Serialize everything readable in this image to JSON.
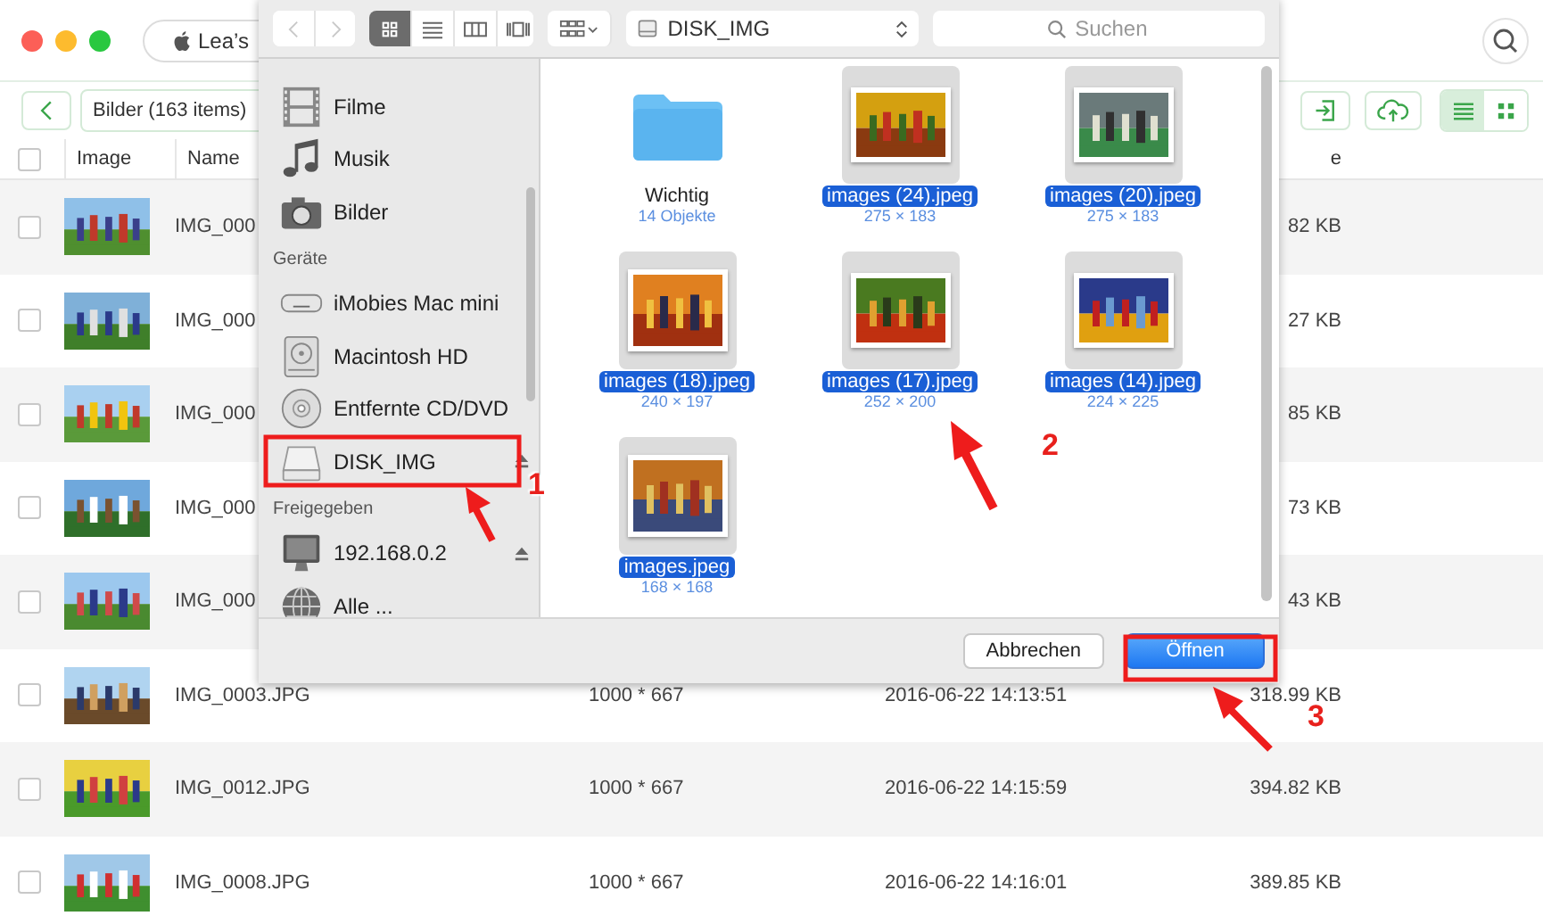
{
  "app": {
    "device_pill": "Lea’s",
    "breadcrumb": "Bilder (163 items)",
    "view_toggle": [
      {
        "kind": "list",
        "selected": true
      },
      {
        "kind": "grid",
        "selected": false
      }
    ],
    "table": {
      "select_all_checked": false,
      "columns": [
        "Image",
        "Name",
        "e"
      ],
      "rows": [
        {
          "checked": false,
          "name": "IMG_000",
          "size": "82 KB"
        },
        {
          "checked": false,
          "name": "IMG_000",
          "size": "27 KB"
        },
        {
          "checked": false,
          "name": "IMG_000",
          "size": "85 KB"
        },
        {
          "checked": false,
          "name": "IMG_000",
          "size": "73 KB"
        },
        {
          "checked": false,
          "name": "IMG_000",
          "size": "43 KB"
        },
        {
          "checked": false,
          "name": "IMG_0003.JPG",
          "dimensions": "1000 * 667",
          "date": "2016-06-22 14:13:51",
          "size": "318.99 KB"
        },
        {
          "checked": false,
          "name": "IMG_0012.JPG",
          "dimensions": "1000 * 667",
          "date": "2016-06-22 14:15:59",
          "size": "394.82 KB"
        },
        {
          "checked": false,
          "name": "IMG_0008.JPG",
          "dimensions": "1000 * 667",
          "date": "2016-06-22 14:16:01",
          "size": "389.85 KB"
        }
      ]
    }
  },
  "dialog": {
    "toolbar": {
      "view_modes": [
        {
          "kind": "icon",
          "selected": true
        },
        {
          "kind": "list",
          "selected": false
        },
        {
          "kind": "columns",
          "selected": false
        },
        {
          "kind": "coverflow",
          "selected": false
        }
      ],
      "location": "DISK_IMG",
      "search": {
        "placeholder": "Suchen"
      }
    },
    "sidebar": [
      {
        "kind": "item",
        "label": "Filme",
        "ejectable": false
      },
      {
        "kind": "item",
        "label": "Musik",
        "ejectable": false
      },
      {
        "kind": "item",
        "label": "Bilder",
        "ejectable": false
      },
      {
        "kind": "heading",
        "label": "Geräte"
      },
      {
        "kind": "item",
        "label": "iMobies Mac mini",
        "ejectable": false
      },
      {
        "kind": "item",
        "label": "Macintosh HD",
        "ejectable": false
      },
      {
        "kind": "item",
        "label": "Entfernte CD/DVD",
        "ejectable": false
      },
      {
        "kind": "item",
        "label": "DISK_IMG",
        "ejectable": true
      },
      {
        "kind": "heading",
        "label": "Freigegeben"
      },
      {
        "kind": "item",
        "label": "192.168.0.2",
        "ejectable": true
      },
      {
        "kind": "item",
        "label": "Alle ...",
        "ejectable": false
      }
    ],
    "files": [
      {
        "kind": "folder",
        "name": "Wichtig",
        "info": "14 Objekte",
        "selected": false
      },
      {
        "name": "images (24).jpeg",
        "info": "275 × 183",
        "selected": true
      },
      {
        "name": "images (20).jpeg",
        "info": "275 × 183",
        "selected": true
      },
      {
        "name": "images (18).jpeg",
        "info": "240 × 197",
        "selected": true
      },
      {
        "name": "images (17).jpeg",
        "info": "252 × 200",
        "selected": true
      },
      {
        "name": "images (14).jpeg",
        "info": "224 × 225",
        "selected": true
      },
      {
        "name": "images.jpeg",
        "info": "168 × 168",
        "selected": true
      }
    ],
    "buttons": [
      {
        "kind": "cancel",
        "label": "Abbrechen"
      },
      {
        "kind": "default",
        "label": "Öffnen"
      }
    ]
  },
  "annotations": [
    {
      "label": "1"
    },
    {
      "label": "2"
    },
    {
      "label": "3"
    }
  ]
}
